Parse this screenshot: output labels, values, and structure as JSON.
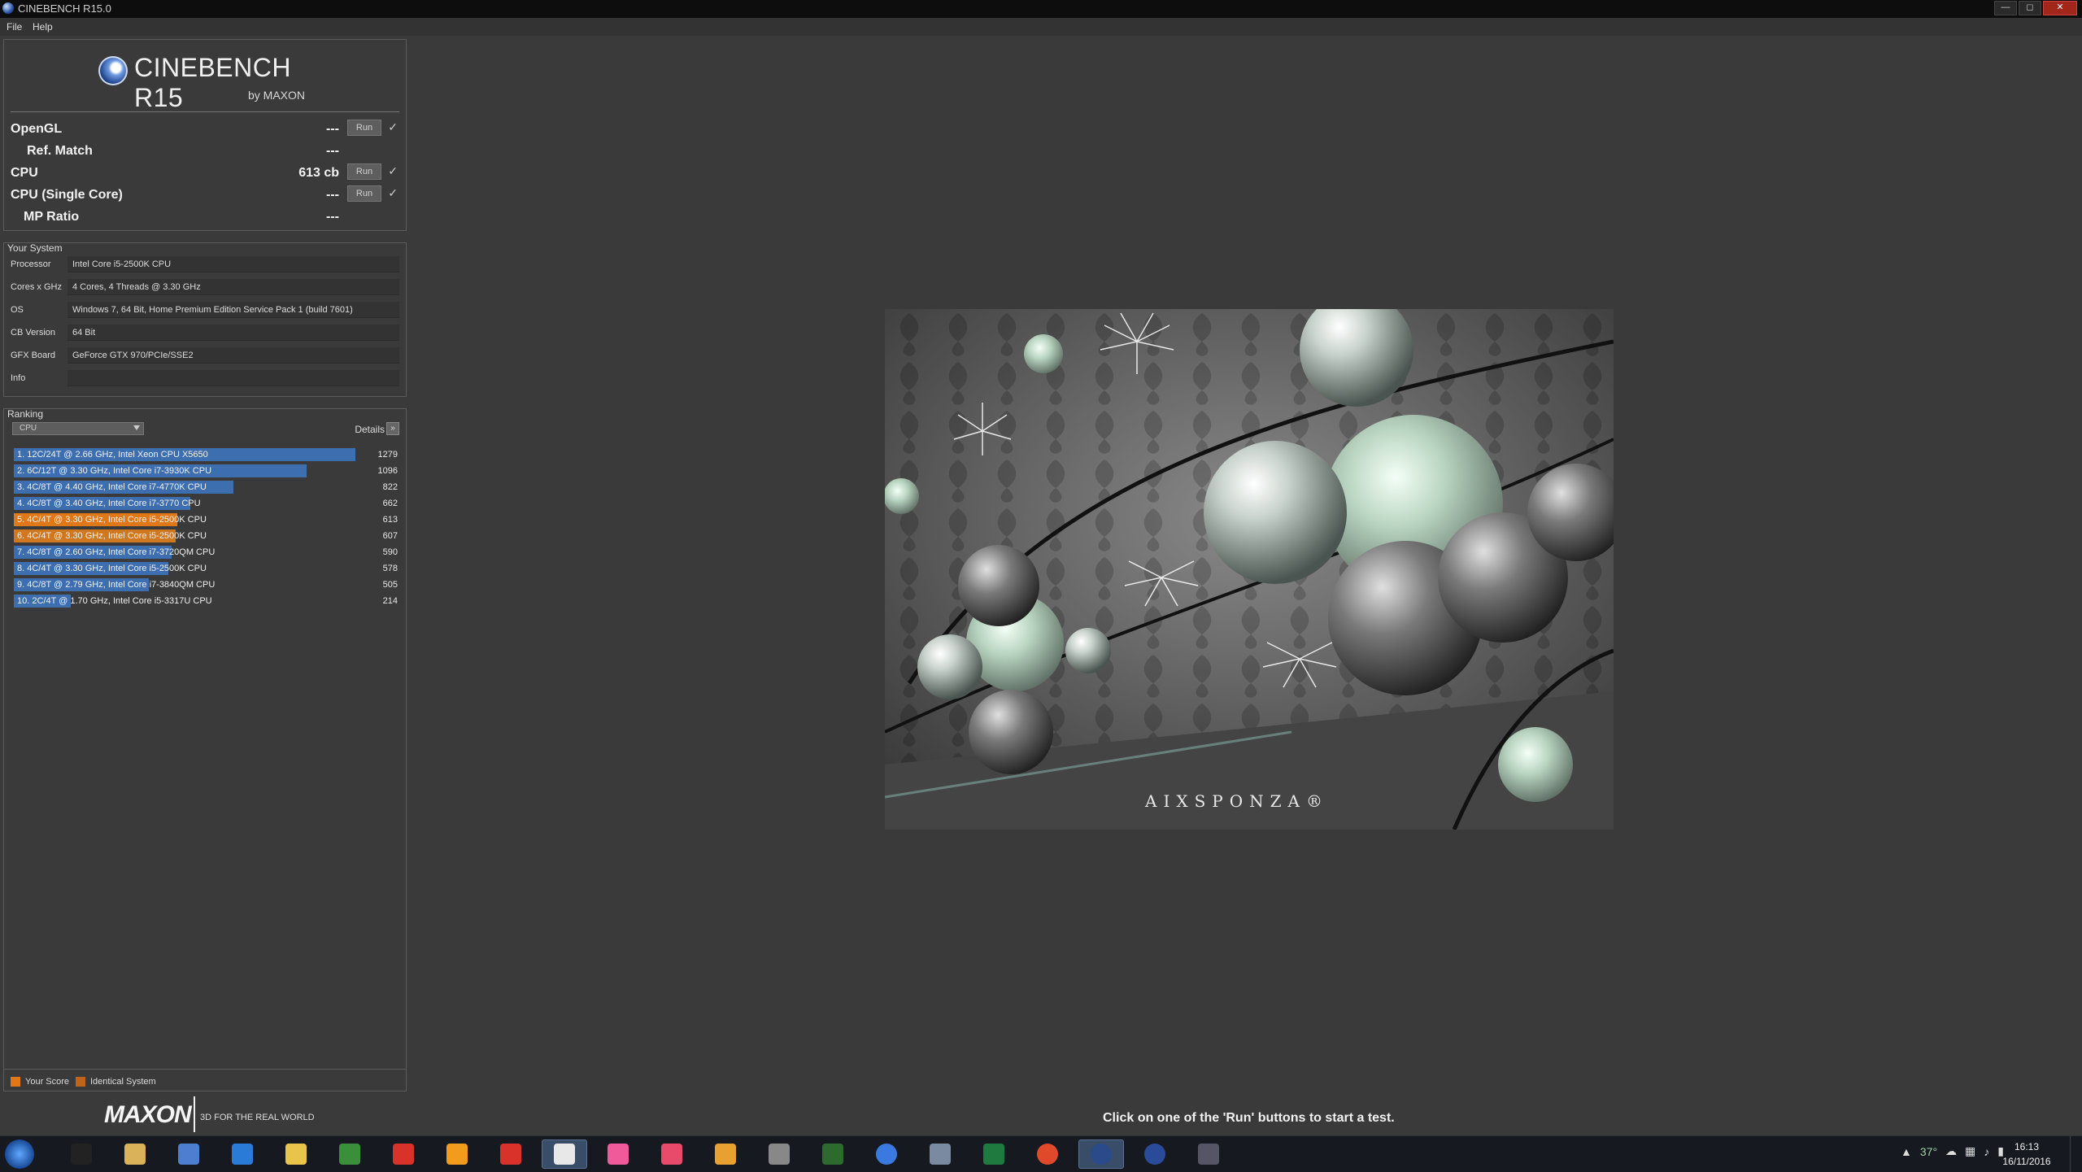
{
  "window": {
    "title": "CINEBENCH R15.0",
    "controls": [
      "—",
      "◻",
      "✕"
    ]
  },
  "menu": [
    "File",
    "Help"
  ],
  "logo": {
    "name": "CINEBENCH R15",
    "by": "by MAXON"
  },
  "tests": [
    {
      "label": "OpenGL",
      "value": "---",
      "run": "Run",
      "check": "✓"
    },
    {
      "label": "Ref. Match",
      "value": "---"
    },
    {
      "label": "CPU",
      "value": "613 cb",
      "run": "Run",
      "check": "✓"
    },
    {
      "label": "CPU (Single Core)",
      "value": "---",
      "run": "Run",
      "check": "✓"
    },
    {
      "label": "MP Ratio",
      "value": "---"
    }
  ],
  "system": {
    "title": "Your System",
    "rows": [
      {
        "key": "Processor",
        "value": "Intel Core i5-2500K CPU"
      },
      {
        "key": "Cores x GHz",
        "value": "4 Cores, 4 Threads @ 3.30 GHz"
      },
      {
        "key": "OS",
        "value": "Windows 7, 64 Bit, Home Premium Edition Service Pack 1 (build 7601)"
      },
      {
        "key": "CB Version",
        "value": "64 Bit"
      },
      {
        "key": "GFX Board",
        "value": "GeForce GTX 970/PCIe/SSE2"
      },
      {
        "key": "Info",
        "value": ""
      }
    ]
  },
  "ranking": {
    "title": "Ranking",
    "selector": "CPU",
    "details": "Details",
    "details_btn": "»",
    "max": 1279,
    "items": [
      {
        "label": "1. 12C/24T @ 2.66 GHz, Intel Xeon CPU X5650",
        "score": 1279,
        "kind": "other"
      },
      {
        "label": "2. 6C/12T @ 3.30 GHz,  Intel Core i7-3930K CPU",
        "score": 1096,
        "kind": "other"
      },
      {
        "label": "3. 4C/8T @ 4.40 GHz, Intel Core i7-4770K CPU",
        "score": 822,
        "kind": "other"
      },
      {
        "label": "4. 4C/8T @ 3.40 GHz,  Intel Core i7-3770 CPU",
        "score": 662,
        "kind": "other"
      },
      {
        "label": "5. 4C/4T @ 3.30 GHz,  Intel Core i5-2500K CPU",
        "score": 613,
        "kind": "me"
      },
      {
        "label": "6. 4C/4T @ 3.30 GHz,  Intel Core i5-2500K CPU",
        "score": 607,
        "kind": "ident"
      },
      {
        "label": "7. 4C/8T @ 2.60 GHz, Intel Core i7-3720QM CPU",
        "score": 590,
        "kind": "other"
      },
      {
        "label": "8. 4C/4T @ 3.30 GHz,  Intel Core i5-2500K CPU",
        "score": 578,
        "kind": "other"
      },
      {
        "label": "9. 4C/8T @ 2.79 GHz,  Intel Core i7-3840QM CPU",
        "score": 505,
        "kind": "other"
      },
      {
        "label": "10. 2C/4T @ 1.70 GHz,  Intel Core i5-3317U CPU",
        "score": 214,
        "kind": "other"
      }
    ],
    "legend": {
      "your_score": "Your Score",
      "identical": "Identical System"
    }
  },
  "colors": {
    "your_score": "#e07818",
    "identical": "#c0641a",
    "bar": "#3d6fb0"
  },
  "footer": {
    "brand": "MAXON",
    "tagline": "3D FOR THE REAL WORLD",
    "status": "Click on one of the 'Run' buttons to start a test."
  },
  "render": {
    "caption": "AIXSPONZA®"
  },
  "taskbar": {
    "icons": [
      "terminal-icon",
      "folder-icon",
      "document-icon",
      "cloud-icon",
      "explorer-icon",
      "xbox-icon",
      "pdf-icon",
      "media-icon",
      "vivaldi-icon",
      "paint-icon",
      "photos-icon",
      "color-icon",
      "color-icon",
      "settings-icon",
      "screen-icon",
      "chrome-icon",
      "box-icon",
      "excel-icon",
      "chrome-icon",
      "cinebench-icon",
      "cinebench-icon",
      "tool-icon"
    ],
    "tray_temp": "37°",
    "time": "16:13",
    "date": "16/11/2016"
  }
}
